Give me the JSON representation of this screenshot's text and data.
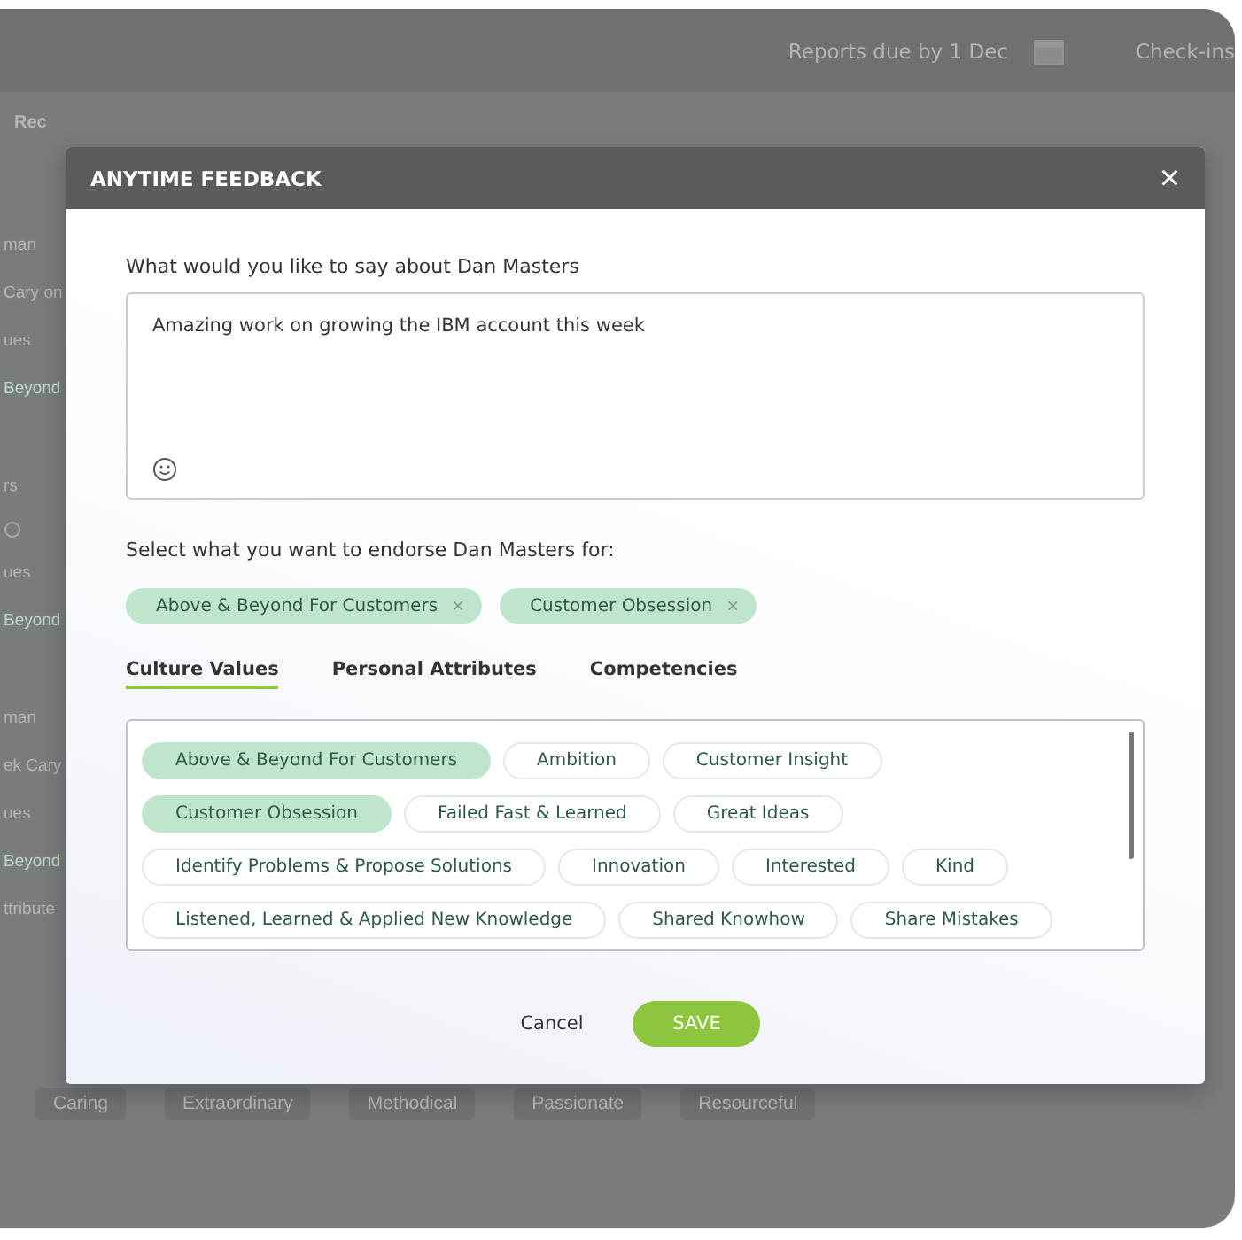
{
  "background": {
    "header": {
      "reports_due": "Reports due by 1 Dec",
      "check_ins": "Check-ins"
    },
    "side_label": "Rec",
    "groups": [
      {
        "lines": [
          {
            "text": "man",
            "kind": "text"
          },
          {
            "text": "Cary on",
            "kind": "text"
          },
          {
            "text": "ues",
            "kind": "text"
          },
          {
            "text": "Beyond",
            "kind": "tag"
          }
        ]
      },
      {
        "lines": [
          {
            "text": "rs",
            "kind": "text"
          },
          {
            "kind": "icon"
          },
          {
            "text": "ues",
            "kind": "text"
          },
          {
            "text": "Beyond",
            "kind": "tag"
          }
        ]
      },
      {
        "lines": [
          {
            "text": "man",
            "kind": "text"
          },
          {
            "text": "ek Cary",
            "kind": "text"
          },
          {
            "text": "ues",
            "kind": "text"
          },
          {
            "text": "Beyond",
            "kind": "tag"
          },
          {
            "text": "ttribute",
            "kind": "text"
          }
        ]
      }
    ],
    "attribute_chips": [
      "Caring",
      "Extraordinary",
      "Methodical",
      "Passionate",
      "Resourceful"
    ]
  },
  "modal": {
    "title": "ANYTIME FEEDBACK",
    "close": "×",
    "question": "What would you like to say about Dan Masters",
    "message": "Amazing work on growing the IBM account this week",
    "endorse_label": "Select what you want to endorse Dan Masters for:",
    "endorsements": [
      {
        "label": "Above & Beyond For Customers",
        "remove": "×"
      },
      {
        "label": "Customer Obsession",
        "remove": "×"
      }
    ],
    "tabs": [
      {
        "label": "Culture Values",
        "selected": true
      },
      {
        "label": "Personal Attributes",
        "selected": false
      },
      {
        "label": "Competencies",
        "selected": false
      }
    ],
    "values": [
      [
        {
          "label": "Above & Beyond For Customers",
          "selected": true
        },
        {
          "label": "Ambition",
          "selected": false
        },
        {
          "label": "Customer Insight",
          "selected": false
        }
      ],
      [
        {
          "label": "Customer Obsession",
          "selected": true
        },
        {
          "label": "Failed Fast & Learned",
          "selected": false
        },
        {
          "label": "Great Ideas",
          "selected": false
        }
      ],
      [
        {
          "label": "Identify Problems & Propose Solutions",
          "selected": false
        },
        {
          "label": "Innovation",
          "selected": false
        },
        {
          "label": "Interested",
          "selected": false
        },
        {
          "label": "Kind",
          "selected": false
        }
      ],
      [
        {
          "label": "Listened, Learned & Applied New Knowledge",
          "selected": false
        },
        {
          "label": "Shared Knowhow",
          "selected": false
        },
        {
          "label": "Share Mistakes",
          "selected": false
        }
      ]
    ],
    "cancel": "Cancel",
    "save": "SAVE"
  }
}
